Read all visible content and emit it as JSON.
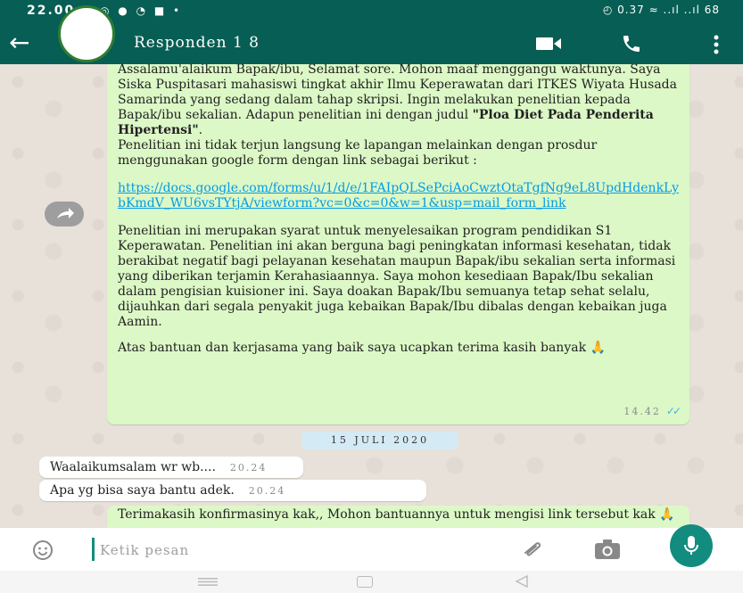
{
  "status_bar": {
    "time": "22.00",
    "notifications": "◎ ● ◔ ■ •",
    "right": "◴ 0.37 ≈ ..ıl ..ıl 68"
  },
  "header": {
    "title": "Responden 1 8"
  },
  "messages": {
    "m1": {
      "p1": "Assalamu'alaikum Bapak/ibu, Selamat sore. Mohon maaf menggangu waktunya. Saya Siska Puspitasari mahasiswi tingkat akhir Ilmu Keperawatan dari ITKES Wiyata Husada Samarinda yang sedang dalam tahap skripsi. Ingin melakukan penelitian kepada Bapak/ibu sekalian. Adapun penelitian ini dengan judul ",
      "p1_bold": "\"Ploa Diet Pada Penderita Hipertensi\"",
      "p1_end": ".",
      "p2": "Penelitian ini tidak terjun langsung ke lapangan melainkan dengan prosdur menggunakan google form dengan link sebagai berikut :",
      "link": "https://docs.google.com/forms/u/1/d/e/1FAIpQLSePciAoCwztOtaTgfNg9eL8UpdHdenkLybKmdV_WU6vsTYtjA/viewform?vc=0&c=0&w=1&usp=mail_form_link",
      "p3": "Penelitian ini merupakan syarat untuk menyelesaikan program pendidikan S1 Keperawatan. Penelitian ini akan berguna bagi peningkatan informasi kesehatan, tidak berakibat negatif bagi pelayanan kesehatan maupun Bapak/ibu sekalian serta informasi yang diberikan terjamin Kerahasiaannya. Saya mohon kesediaan Bapak/Ibu sekalian dalam pengisian kuisioner ini. Saya doakan Bapak/Ibu semuanya tetap sehat selalu, dijauhkan dari segala penyakit juga kebaikan Bapak/Ibu dibalas dengan kebaikan juga Aamin.",
      "p4": "Atas bantuan dan kerjasama yang baik saya ucapkan terima kasih banyak 🙏",
      "time": "14.42"
    },
    "date_chip": "15 JULI 2020",
    "m2": {
      "text": "Waalaikumsalam wr wb....",
      "time": "20.24"
    },
    "m3": {
      "text": "Apa yg bisa saya bantu adek.",
      "time": "20.24"
    },
    "m4": {
      "text": "Terimakasih konfirmasinya kak,, Mohon bantuannya untuk mengisi link tersebut kak 🙏"
    }
  },
  "input": {
    "placeholder": "Ketik pesan"
  },
  "icons": [
    "back-arrow-icon",
    "video-call-icon",
    "phone-icon",
    "menu-icon",
    "forward-icon",
    "emoji-icon",
    "attach-icon",
    "camera-icon",
    "mic-icon"
  ],
  "colors": {
    "header": "#075e54",
    "outgoing_bubble": "#dcf8c6",
    "incoming_bubble": "#ffffff",
    "accent": "#128c7e",
    "link": "#039be5"
  }
}
